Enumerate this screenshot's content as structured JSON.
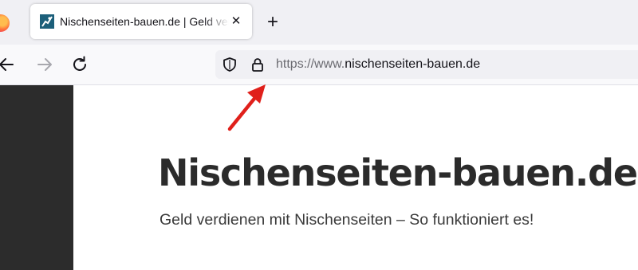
{
  "browser": {
    "tab": {
      "title": "Nischenseiten-bauen.de | Geld verdienen mit Nischenseiten",
      "close_glyph": "✕",
      "favicon": "nischenseiten-favicon"
    },
    "new_tab_glyph": "+",
    "nav": {
      "back_icon": "arrow-left-icon",
      "forward_icon": "arrow-right-icon",
      "reload_icon": "reload-icon"
    },
    "address_bar": {
      "shield_icon": "shield-icon",
      "lock_icon": "lock-icon",
      "url_prefix": "https://www.",
      "url_domain": "nischenseiten-bauen.de"
    }
  },
  "page": {
    "title": "Nischenseiten-bauen.de",
    "tagline": "Geld verdienen mit Nischenseiten – So funktioniert es!"
  },
  "annotation": {
    "arrow_color": "#e0201b",
    "points_to": "lock-icon"
  }
}
